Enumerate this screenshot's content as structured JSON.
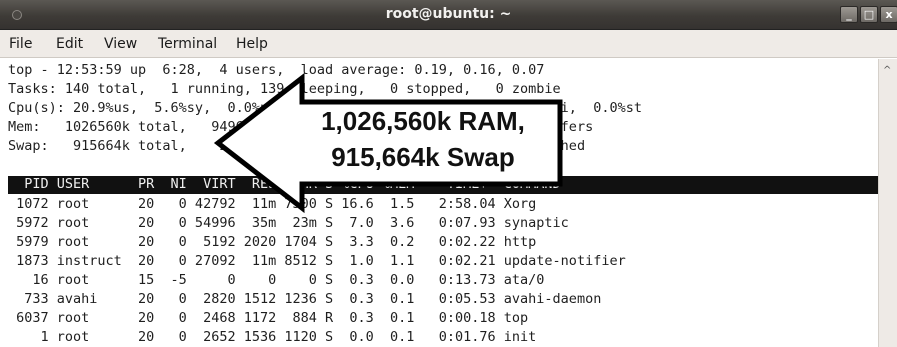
{
  "window": {
    "title": "root@ubuntu: ~",
    "controls": {
      "minimize": "_",
      "maximize": "□",
      "close": "x"
    },
    "icon": "window-menu-icon"
  },
  "menubar": {
    "items": [
      {
        "label": "File"
      },
      {
        "label": "Edit"
      },
      {
        "label": "View"
      },
      {
        "label": "Terminal"
      },
      {
        "label": "Help"
      }
    ]
  },
  "terminal": {
    "summary": [
      "top - 12:53:59 up  6:28,  4 users,  load average: 0.19, 0.16, 0.07",
      "Tasks: 140 total,   1 running, 139 sleeping,   0 stopped,   0 zombie",
      "Cpu(s): 20.9%us,  5.6%sy,  0.0%ni, 72.2%id,  0.0%wa,  0.0%hi,  1.3%si,  0.0%st",
      "Mem:   1026560k total,   949628k used,    76932k free,    80596k buffers",
      "Swap:   915664k total,    21280k used,   894384k free,   344548k cached"
    ],
    "header": "  PID USER      PR  NI  VIRT  RES  SHR S %CPU %MEM    TIME+  COMMAND",
    "processes": [
      " 1072 root      20   0 42792  11m 7500 S 16.6  1.5   2:58.04 Xorg",
      " 5972 root      20   0 54996  35m  23m S  7.0  3.6   0:07.93 synaptic",
      " 5979 root      20   0  5192 2020 1704 S  3.3  0.2   0:02.22 http",
      " 1873 instruct  20   0 27092  11m 8512 S  1.0  1.1   0:02.21 update-notifier",
      "   16 root      15  -5     0    0    0 S  0.3  0.0   0:13.73 ata/0",
      "  733 avahi     20   0  2820 1512 1236 S  0.3  0.1   0:05.53 avahi-daemon",
      " 6037 root      20   0  2468 1172  884 R  0.3  0.1   0:00.18 top",
      "    1 root      20   0  2652 1536 1120 S  0.0  0.1   0:01.76 init"
    ]
  },
  "callout": {
    "line1": "1,026,560k RAM,",
    "line2": "915,664k Swap",
    "fill": "#ffffff",
    "stroke": "#000000"
  },
  "scrollbar": {
    "up_arrow": "^"
  }
}
